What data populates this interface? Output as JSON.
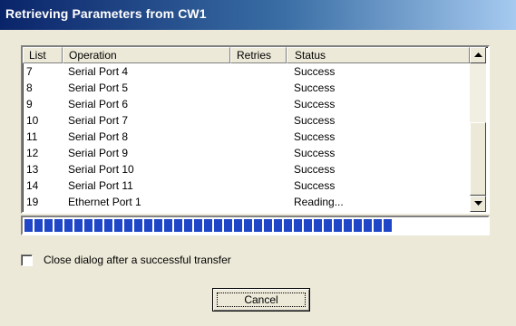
{
  "window": {
    "title": "Retrieving Parameters from CW1"
  },
  "list": {
    "columns": [
      "List",
      "Operation",
      "Retries",
      "Status"
    ],
    "rows": [
      {
        "list": "7",
        "operation": "Serial Port 4",
        "retries": "",
        "status": "Success"
      },
      {
        "list": "8",
        "operation": "Serial Port 5",
        "retries": "",
        "status": "Success"
      },
      {
        "list": "9",
        "operation": "Serial Port 6",
        "retries": "",
        "status": "Success"
      },
      {
        "list": "10",
        "operation": "Serial Port 7",
        "retries": "",
        "status": "Success"
      },
      {
        "list": "11",
        "operation": "Serial Port 8",
        "retries": "",
        "status": "Success"
      },
      {
        "list": "12",
        "operation": "Serial Port 9",
        "retries": "",
        "status": "Success"
      },
      {
        "list": "13",
        "operation": "Serial Port 10",
        "retries": "",
        "status": "Success"
      },
      {
        "list": "14",
        "operation": "Serial Port 11",
        "retries": "",
        "status": "Success"
      },
      {
        "list": "19",
        "operation": "Ethernet Port 1",
        "retries": "",
        "status": "Reading..."
      }
    ]
  },
  "progress": {
    "fraction": 0.79
  },
  "close_after_transfer": {
    "label": "Close dialog after a successful transfer",
    "checked": false
  },
  "buttons": {
    "cancel": "Cancel"
  }
}
